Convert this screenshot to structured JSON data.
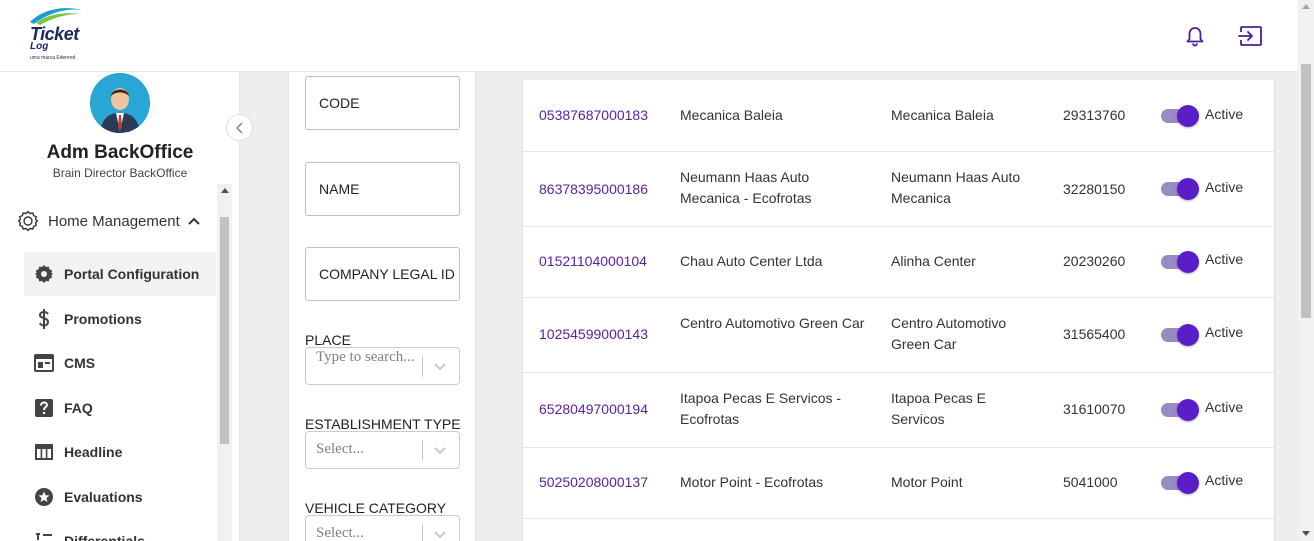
{
  "brand": {
    "name": "Ticket",
    "sub": "Log",
    "tagline": "uma marca Edenred"
  },
  "user": {
    "name": "Adm BackOffice",
    "role": "Brain Director BackOffice"
  },
  "menu": {
    "group": "Home Management",
    "items": [
      {
        "label": "Portal Configuration",
        "icon": "gear-icon",
        "active": true
      },
      {
        "label": "Promotions",
        "icon": "dollar-icon"
      },
      {
        "label": "CMS",
        "icon": "browser-window-icon"
      },
      {
        "label": "FAQ",
        "icon": "help-icon"
      },
      {
        "label": "Headline",
        "icon": "table-icon"
      },
      {
        "label": "Evaluations",
        "icon": "star-icon"
      },
      {
        "label": "Differentials",
        "icon": "list-icon"
      }
    ]
  },
  "filters": {
    "code": "CODE",
    "name": "NAME",
    "company_legal_id": "COMPANY LEGAL ID",
    "place": {
      "label": "PLACE",
      "placeholder": "Type to search..."
    },
    "establishment_type": {
      "label": "ESTABLISHMENT TYPE",
      "placeholder": "Select..."
    },
    "vehicle_category": {
      "label": "VEHICLE CATEGORY",
      "placeholder": "Select..."
    }
  },
  "colors": {
    "accent": "#5a1ec8",
    "link": "#5a1ea0",
    "track": "#9a8ac4"
  },
  "rows": [
    {
      "code": "05387687000183",
      "name": "Mecanica Baleia",
      "legal": "Mecanica Baleia",
      "number": "29313760",
      "status": "Active",
      "active": true
    },
    {
      "code": "86378395000186",
      "name": "Neumann Haas Auto Mecanica - Ecofrotas",
      "legal": "Neumann Haas Auto Mecanica",
      "number": "32280150",
      "status": "Active",
      "active": true
    },
    {
      "code": "01521104000104",
      "name": "Chau Auto Center Ltda",
      "legal": "Alinha Center",
      "number": "20230260",
      "status": "Active",
      "active": true
    },
    {
      "code": "10254599000143",
      "name": "Centro Automotivo Green Car",
      "legal": "Centro Automotivo Green Car",
      "number": "31565400",
      "status": "Active",
      "active": true
    },
    {
      "code": "65280497000194",
      "name": "Itapoa Pecas E Servicos - Ecofrotas",
      "legal": "Itapoa Pecas E Servicos",
      "number": "31610070",
      "status": "Active",
      "active": true
    },
    {
      "code": "50250208000137",
      "name": "Motor Point - Ecofrotas",
      "legal": "Motor Point",
      "number": "5041000",
      "status": "Active",
      "active": true
    }
  ]
}
